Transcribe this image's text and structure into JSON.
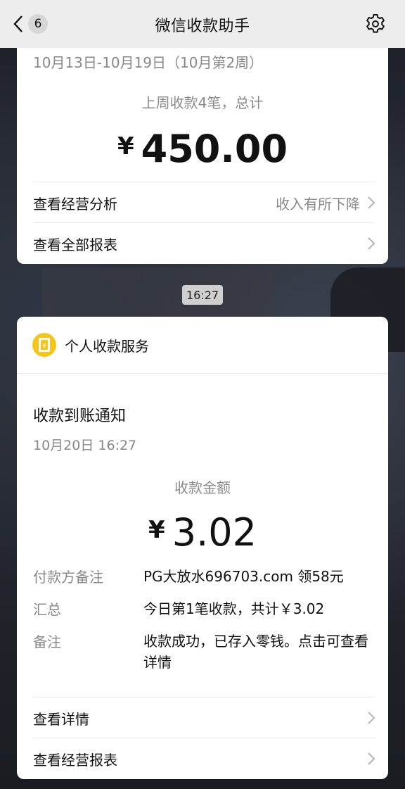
{
  "topbar": {
    "back_count": "6",
    "title": "微信收款助手"
  },
  "weekly_card": {
    "period": "10月13日-10月19日（10月第2周）",
    "summary": "上周收款4笔，总计",
    "currency": "¥",
    "amount": "450.00",
    "rows": [
      {
        "label": "查看经营分析",
        "note": "收入有所下降"
      },
      {
        "label": "查看全部报表",
        "note": ""
      }
    ]
  },
  "time_divider": "16:27",
  "payment_card": {
    "service_name": "个人收款服务",
    "notice_title": "收款到账通知",
    "notice_time": "10月20日 16:27",
    "amount_label": "收款金额",
    "currency": "¥",
    "amount": "3.02",
    "details": [
      {
        "key": "付款方备注",
        "value": "PG大放水696703.com 领58元"
      },
      {
        "key": "汇总",
        "value": "今日第1笔收款，共计￥3.02"
      },
      {
        "key": "备注",
        "value": "收款成功，已存入零钱。点击可查看详情"
      }
    ],
    "rows": [
      {
        "label": "查看详情"
      },
      {
        "label": "查看经营报表"
      }
    ]
  },
  "colors": {
    "topbar_bg": "#ededed",
    "card_bg": "#ffffff",
    "service_icon": "#f5c518",
    "muted_text": "#888888"
  },
  "icons": {
    "back": "chevron-left-icon",
    "settings": "gear-icon",
    "row_arrow": "chevron-right-icon",
    "service": "wallet-icon"
  }
}
